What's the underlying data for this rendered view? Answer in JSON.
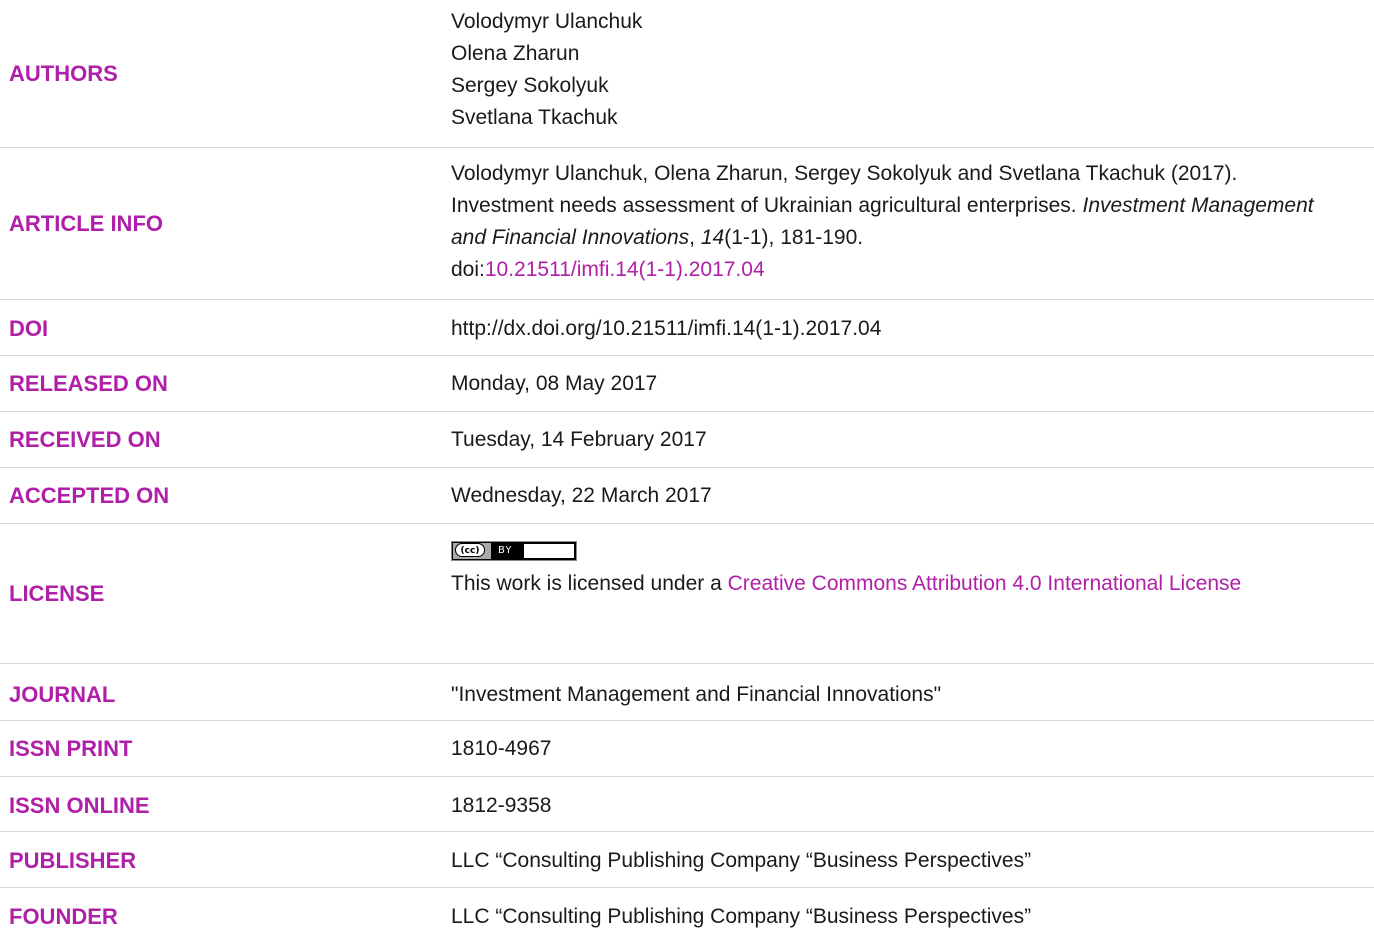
{
  "authors": {
    "label": "AUTHORS",
    "names": [
      "Volodymyr Ulanchuk",
      "Olena Zharun",
      "Sergey Sokolyuk",
      "Svetlana Tkachuk"
    ]
  },
  "article_info": {
    "label": "ARTICLE INFO",
    "citation_main": "Volodymyr Ulanchuk, Olena Zharun, Sergey Sokolyuk and Svetlana Tkachuk (2017). Investment needs assessment of Ukrainian agricultural enterprises.",
    "journal_italic": "Investment Management and Financial Innovations",
    "comma": ", ",
    "volume_italic": "14",
    "issue_pages": "(1-1), 181-190.",
    "doi_prefix": "doi:",
    "doi_link": "10.21511/imfi.14(1-1).2017.04"
  },
  "doi": {
    "label": "DOI",
    "value": "http://dx.doi.org/10.21511/imfi.14(1-1).2017.04"
  },
  "released": {
    "label": "RELEASED ON",
    "value": "Monday, 08 May 2017"
  },
  "received": {
    "label": "RECEIVED ON",
    "value": "Tuesday, 14 February 2017"
  },
  "accepted": {
    "label": "ACCEPTED ON",
    "value": "Wednesday, 22 March 2017"
  },
  "license": {
    "label": "LICENSE",
    "badge_cc": "(cc)",
    "badge_by": "BY",
    "text_prefix": "This work is licensed under a ",
    "link_text": "Creative Commons Attribution 4.0 International License"
  },
  "journal": {
    "label": "JOURNAL",
    "value": "\"Investment Management and Financial Innovations\""
  },
  "issn_print": {
    "label": "ISSN PRINT",
    "value": "1810-4967"
  },
  "issn_online": {
    "label": "ISSN ONLINE",
    "value": "1812-9358"
  },
  "publisher": {
    "label": "PUBLISHER",
    "value": "LLC “Consulting Publishing Company “Business Perspectives”"
  },
  "founder": {
    "label": "FOUNDER",
    "value": "LLC “Consulting Publishing Company “Business Perspectives”"
  },
  "colors": {
    "label": "#b01fa8",
    "text": "#1a1a1a",
    "divider": "#d9d9d9"
  }
}
